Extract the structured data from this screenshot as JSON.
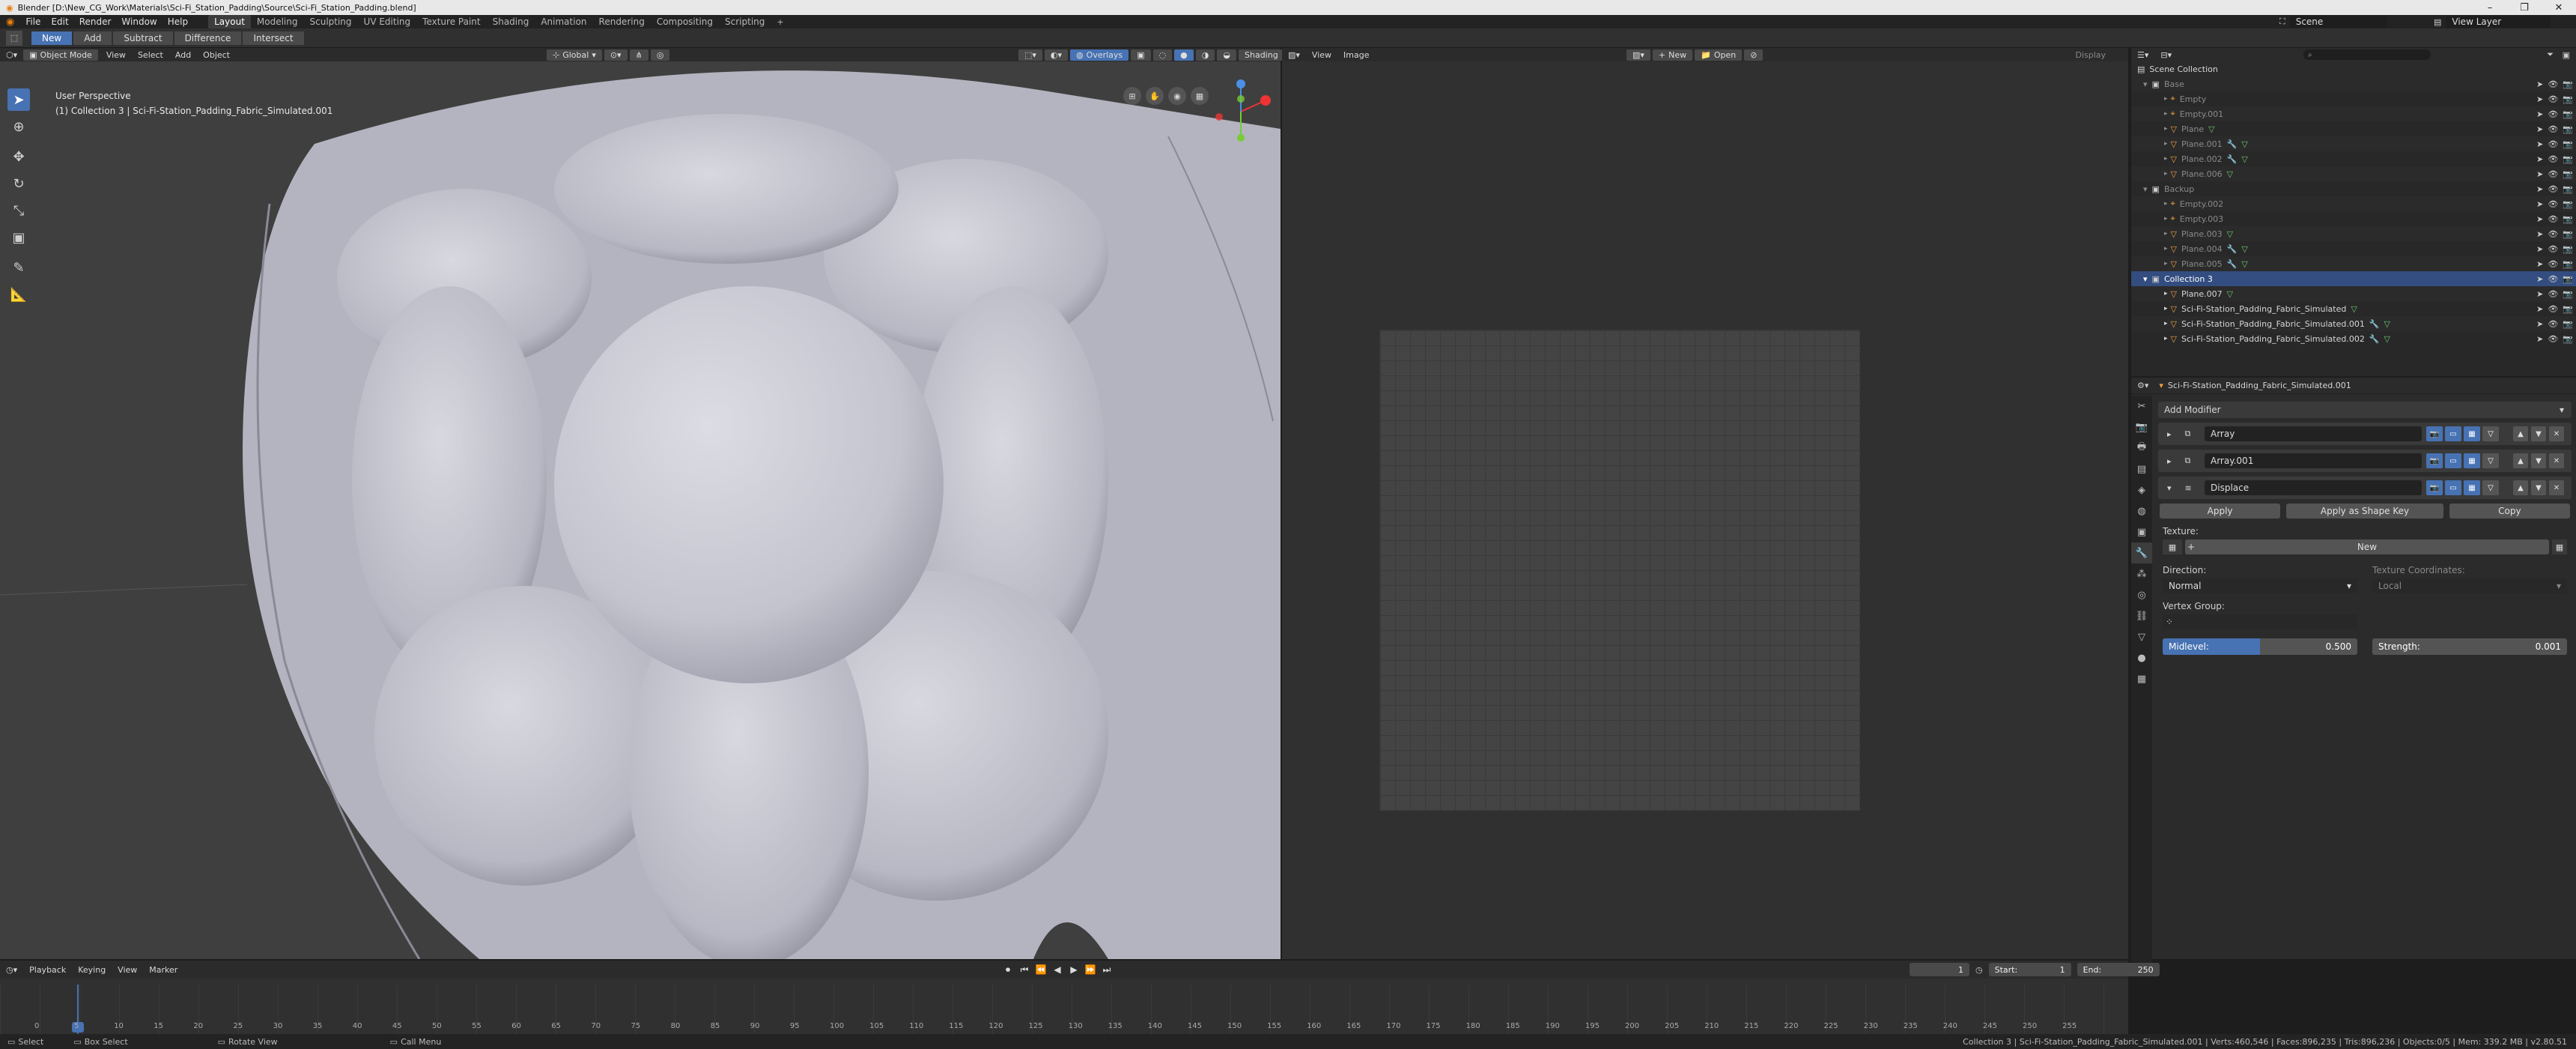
{
  "window": {
    "title": "Blender [D:\\New_CG_Work\\Materials\\Sci-Fi_Station_Padding\\Source\\Sci-Fi_Station_Padding.blend]"
  },
  "topbar": {
    "menus": [
      "File",
      "Edit",
      "Render",
      "Window",
      "Help"
    ],
    "workspaces": [
      "Layout",
      "Modeling",
      "Sculpting",
      "UV Editing",
      "Texture Paint",
      "Shading",
      "Animation",
      "Rendering",
      "Compositing",
      "Scripting"
    ],
    "active_workspace": "Layout",
    "scene": "Scene",
    "view_layer": "View Layer"
  },
  "toolheader": {
    "bool_ops": [
      "New",
      "Add",
      "Subtract",
      "Difference",
      "Intersect"
    ],
    "active": "New"
  },
  "viewport": {
    "mode": "Object Mode",
    "menus": [
      "View",
      "Select",
      "Add",
      "Object"
    ],
    "orientation": "Global",
    "overlays": "Overlays",
    "shading": "Shading",
    "perspective_label": "User Perspective",
    "object_label": "(1) Collection 3 | Sci-Fi-Station_Padding_Fabric_Simulated.001"
  },
  "image_editor": {
    "menus": [
      "View",
      "Image"
    ],
    "new_label": "New",
    "open_label": "Open",
    "display_label": "Display"
  },
  "outliner": {
    "search_placeholder": "",
    "root": "Scene Collection",
    "rows": [
      {
        "label": "Base",
        "type": "collection",
        "dim": true,
        "green": 0
      },
      {
        "label": "Empty",
        "type": "empty",
        "dim": true,
        "green": 0
      },
      {
        "label": "Empty.001",
        "type": "empty",
        "dim": true,
        "green": 0
      },
      {
        "label": "Plane",
        "type": "mesh",
        "dim": true,
        "green": 1
      },
      {
        "label": "Plane.001",
        "type": "mesh",
        "dim": true,
        "green": 2
      },
      {
        "label": "Plane.002",
        "type": "mesh",
        "dim": true,
        "green": 2
      },
      {
        "label": "Plane.006",
        "type": "mesh",
        "dim": true,
        "green": 1
      },
      {
        "label": "Backup",
        "type": "collection",
        "dim": true,
        "green": 0
      },
      {
        "label": "Empty.002",
        "type": "empty",
        "dim": true,
        "green": 0
      },
      {
        "label": "Empty.003",
        "type": "empty",
        "dim": true,
        "green": 0
      },
      {
        "label": "Plane.003",
        "type": "mesh",
        "dim": true,
        "green": 1
      },
      {
        "label": "Plane.004",
        "type": "mesh",
        "dim": true,
        "green": 2
      },
      {
        "label": "Plane.005",
        "type": "mesh",
        "dim": true,
        "green": 2
      },
      {
        "label": "Collection 3",
        "type": "collection",
        "dim": false,
        "selected": true,
        "green": 0
      },
      {
        "label": "Plane.007",
        "type": "mesh",
        "dim": false,
        "green": 1
      },
      {
        "label": "Sci-Fi-Station_Padding_Fabric_Simulated",
        "type": "mesh",
        "dim": false,
        "green": 1
      },
      {
        "label": "Sci-Fi-Station_Padding_Fabric_Simulated.001",
        "type": "mesh",
        "dim": false,
        "green": 2
      },
      {
        "label": "Sci-Fi-Station_Padding_Fabric_Simulated.002",
        "type": "mesh",
        "dim": false,
        "green": 2
      }
    ]
  },
  "properties": {
    "object_name": "Sci-Fi-Station_Padding_Fabric_Simulated.001",
    "add_modifier": "Add Modifier",
    "modifiers": [
      {
        "name": "Array"
      },
      {
        "name": "Array.001"
      },
      {
        "name": "Displace"
      }
    ],
    "apply": "Apply",
    "apply_shape": "Apply as Shape Key",
    "copy": "Copy",
    "texture_label": "Texture:",
    "texture_new": "New",
    "direction_label": "Direction:",
    "direction_value": "Normal",
    "texcoords_label": "Texture Coordinates:",
    "texcoords_value": "Local",
    "vgroup_label": "Vertex Group:",
    "midlevel_label": "Midlevel:",
    "midlevel_value": "0.500",
    "midlevel_fraction": 0.5,
    "strength_label": "Strength:",
    "strength_value": "0.001"
  },
  "timeline": {
    "menus": [
      "Playback",
      "Keying",
      "View",
      "Marker"
    ],
    "current_frame": "1",
    "start_label": "Start:",
    "start_value": "1",
    "end_label": "End:",
    "end_value": "250",
    "ticks": [
      "0",
      "5",
      "10",
      "15",
      "20",
      "25",
      "30",
      "35",
      "40",
      "45",
      "50",
      "55",
      "60",
      "65",
      "70",
      "75",
      "80",
      "85",
      "90",
      "95",
      "100",
      "105",
      "110",
      "115",
      "120",
      "125",
      "130",
      "135",
      "140",
      "145",
      "150",
      "155",
      "160",
      "165",
      "170",
      "175",
      "180",
      "185",
      "190",
      "195",
      "200",
      "205",
      "210",
      "215",
      "220",
      "225",
      "230",
      "235",
      "240",
      "245",
      "250",
      "255"
    ]
  },
  "statusbar": {
    "select": "Select",
    "box_select": "Box Select",
    "rotate_view": "Rotate View",
    "call_menu": "Call Menu",
    "stats": "Collection 3 | Sci-Fi-Station_Padding_Fabric_Simulated.001 | Verts:460,546 | Faces:896,235 | Tris:896,236 | Objects:0/5 | Mem: 339.2 MB | v2.80.51"
  }
}
